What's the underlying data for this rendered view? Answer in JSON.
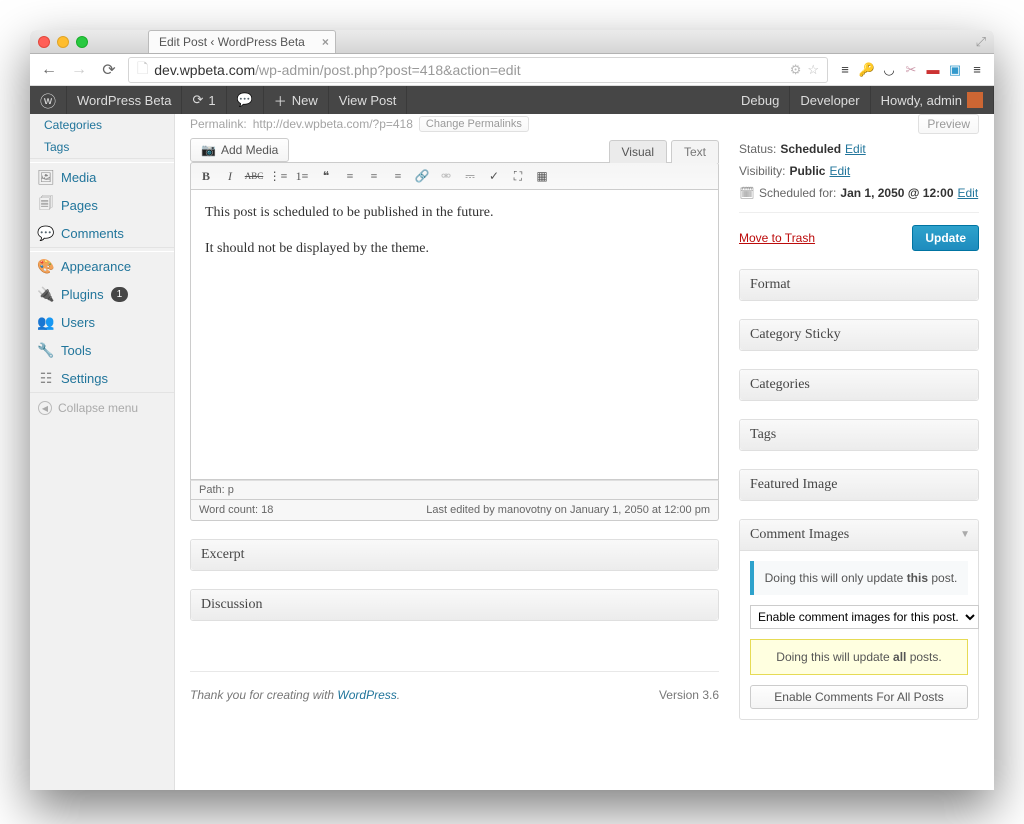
{
  "browser": {
    "tab_title": "Edit Post ‹ WordPress Beta",
    "url_domain": "dev.wpbeta.com",
    "url_path": "/wp-admin/post.php?post=418&action=edit"
  },
  "adminbar": {
    "site_name": "WordPress Beta",
    "updates_count": "1",
    "new_label": "New",
    "view_post": "View Post",
    "debug": "Debug",
    "developer": "Developer",
    "howdy": "Howdy, admin"
  },
  "sidebar": {
    "categories": "Categories",
    "tags": "Tags",
    "media": "Media",
    "pages": "Pages",
    "comments": "Comments",
    "appearance": "Appearance",
    "plugins": "Plugins",
    "plugins_count": "1",
    "users": "Users",
    "tools": "Tools",
    "settings": "Settings",
    "collapse": "Collapse menu"
  },
  "editor": {
    "permalink_label": "Permalink:",
    "permalink_url": "http://dev.wpbeta.com/?p=418",
    "change_permalinks": "Change Permalinks",
    "preview": "Preview",
    "add_media": "Add Media",
    "tab_visual": "Visual",
    "tab_text": "Text",
    "content_p1": "This post is scheduled to be published in the future.",
    "content_p2": "It should not be displayed by the theme.",
    "path": "Path: p",
    "word_count": "Word count: 18",
    "last_edited": "Last edited by manovotny on January 1, 2050 at 12:00 pm",
    "excerpt_title": "Excerpt",
    "discussion_title": "Discussion"
  },
  "publish": {
    "status_label": "Status:",
    "status_value": "Scheduled",
    "status_edit": "Edit",
    "visibility_label": "Visibility:",
    "visibility_value": "Public",
    "visibility_edit": "Edit",
    "schedule_label": "Scheduled for:",
    "schedule_value": "Jan 1, 2050 @ 12:00",
    "schedule_edit": "Edit",
    "trash": "Move to Trash",
    "update": "Update"
  },
  "sideboxes": {
    "format": "Format",
    "category_sticky": "Category Sticky",
    "categories": "Categories",
    "tags": "Tags",
    "featured_image": "Featured Image",
    "comment_images": "Comment Images",
    "ci_notice_pre": "Doing this will only update ",
    "ci_notice_bold": "this",
    "ci_notice_post": " post.",
    "ci_select": "Enable comment images for this post.",
    "ci_notice2_pre": "Doing this will update ",
    "ci_notice2_bold": "all",
    "ci_notice2_post": " posts.",
    "ci_button": "Enable Comments For All Posts"
  },
  "footer": {
    "thanks": "Thank you for creating with ",
    "wp": "WordPress",
    "version": "Version 3.6"
  }
}
